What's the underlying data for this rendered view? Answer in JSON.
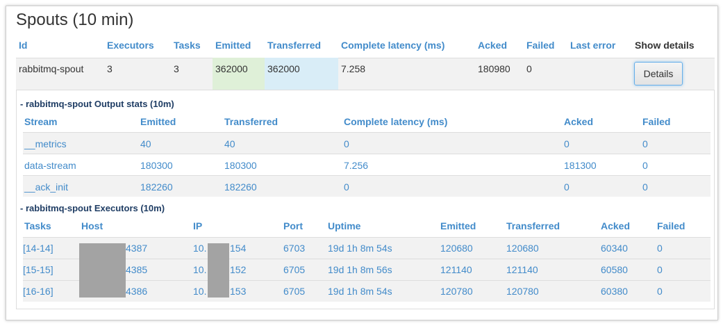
{
  "title": "Spouts (10 min)",
  "spouts_table": {
    "headers": {
      "id": "Id",
      "executors": "Executors",
      "tasks": "Tasks",
      "emitted": "Emitted",
      "transferred": "Transferred",
      "complete_latency": "Complete latency (ms)",
      "acked": "Acked",
      "failed": "Failed",
      "last_error": "Last error",
      "show_details": "Show details"
    },
    "row": {
      "id": "rabbitmq-spout",
      "executors": "3",
      "tasks": "3",
      "emitted": "362000",
      "transferred": "362000",
      "complete_latency": "7.258",
      "acked": "180980",
      "failed": "0",
      "last_error": "",
      "details_label": "Details"
    }
  },
  "output_stats": {
    "title": "- rabbitmq-spout Output stats (10m)",
    "headers": {
      "stream": "Stream",
      "emitted": "Emitted",
      "transferred": "Transferred",
      "complete_latency": "Complete latency (ms)",
      "acked": "Acked",
      "failed": "Failed"
    },
    "rows": [
      {
        "stream": "__metrics",
        "emitted": "40",
        "transferred": "40",
        "complete_latency": "0",
        "acked": "0",
        "failed": "0"
      },
      {
        "stream": "data-stream",
        "emitted": "180300",
        "transferred": "180300",
        "complete_latency": "7.256",
        "acked": "181300",
        "failed": "0"
      },
      {
        "stream": "__ack_init",
        "emitted": "182260",
        "transferred": "182260",
        "complete_latency": "0",
        "acked": "0",
        "failed": "0"
      }
    ]
  },
  "executors": {
    "title": "- rabbitmq-spout Executors (10m)",
    "headers": {
      "tasks": "Tasks",
      "host": "Host",
      "ip": "IP",
      "port": "Port",
      "uptime": "Uptime",
      "emitted": "Emitted",
      "transferred": "Transferred",
      "acked": "Acked",
      "failed": "Failed"
    },
    "rows": [
      {
        "tasks": "[14-14]",
        "host_suffix": "4387",
        "ip_prefix": "10.",
        "ip_suffix": "154",
        "port": "6703",
        "uptime": "19d 1h 8m 54s",
        "emitted": "120680",
        "transferred": "120680",
        "acked": "60340",
        "failed": "0"
      },
      {
        "tasks": "[15-15]",
        "host_suffix": "4385",
        "ip_prefix": "10.",
        "ip_suffix": "152",
        "port": "6705",
        "uptime": "19d 1h 8m 56s",
        "emitted": "121140",
        "transferred": "121140",
        "acked": "60580",
        "failed": "0"
      },
      {
        "tasks": "[16-16]",
        "host_suffix": "4386",
        "ip_prefix": "10.",
        "ip_suffix": "153",
        "port": "6705",
        "uptime": "19d 1h 8m 54s",
        "emitted": "120780",
        "transferred": "120780",
        "acked": "60380",
        "failed": "0"
      }
    ]
  },
  "colors": {
    "link": "#428bca",
    "section_title": "#1f3d64",
    "emitted_highlight": "#dff0d8",
    "transferred_highlight": "#d9edf7",
    "redaction": "#a3a3a3"
  }
}
